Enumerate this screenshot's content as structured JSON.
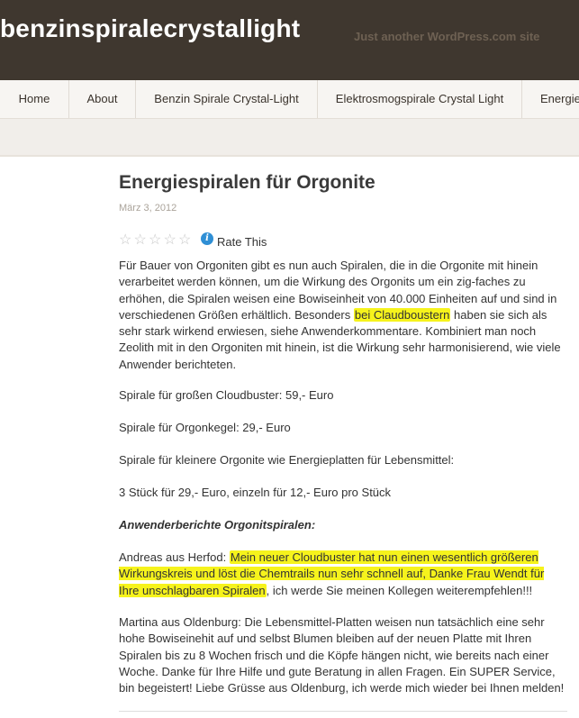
{
  "header": {
    "site_title": "benzinspiralecrystallight",
    "tagline": "Just another WordPress.com site"
  },
  "nav": {
    "items": [
      {
        "label": "Home"
      },
      {
        "label": "About"
      },
      {
        "label": "Benzin Spirale Crystal-Light"
      },
      {
        "label": "Elektrosmogspirale Crystal Light"
      },
      {
        "label": "Energie"
      }
    ]
  },
  "post": {
    "title": "Energiespiralen für Orgonite",
    "date": "März 3, 2012",
    "rating": {
      "stars_filled": 0,
      "stars_total": 5,
      "rate_label": "Rate This",
      "info_icon": "info-icon"
    },
    "p1_a": "Für Bauer von Orgoniten gibt es nun auch Spiralen, die in die Orgonite mit hinein verarbeitet werden können, um die Wirkung des Orgonits um ein zig-faches zu erhöhen, die Spiralen weisen eine Bowiseinheit von 40.000 Einheiten auf und sind in verschiedenen Größen erhältlich. Besonders ",
    "p1_hl": "bei Claudboustern",
    "p1_b": " haben sie sich als sehr stark wirkend erwiesen, siehe Anwenderkommentare. Kombiniert man noch Zeolith mit in den Orgoniten mit hinein, ist die Wirkung sehr harmonisierend, wie viele Anwender berichteten.",
    "price1": "Spirale für großen Cloudbuster: 59,- Euro",
    "price2": "Spirale für Orgonkegel: 29,- Euro",
    "price3": "Spirale für kleinere Orgonite wie Energieplatten für Lebensmittel:",
    "price4": "3 Stück für 29,- Euro, einzeln für 12,- Euro pro Stück",
    "subheading": "Anwenderberichte Orgonitspiralen:",
    "review1_a": "Andreas aus Herfod: ",
    "review1_hl": "Mein neuer Cloudbuster hat nun einen wesentlich größeren Wirkungskreis und löst die Chemtrails nun sehr schnell auf, Danke Frau Wendt für Ihre unschlagbaren Spiralen",
    "review1_b": ", ich werde Sie meinen Kollegen weiterempfehlen!!!",
    "review2": "Martina aus Oldenburg: Die Lebensmittel-Platten weisen nun tatsächlich eine sehr hohe Bowiseinehit auf und selbst Blumen bleiben auf der neuen Platte mit Ihren Spiralen bis zu 8 Wochen frisch und die Köpfe hängen nicht, wie bereits nach einer Woche. Danke für Ihre Hilfe und gute Beratung in allen Fragen. Ein SUPER Service, bin begeistert! Liebe Grüsse aus Oldenburg, ich werde mich wieder bei Ihnen melden!"
  },
  "colors": {
    "header_bg": "#3f372f",
    "highlight": "#f6f31c",
    "info_icon": "#2f8fd5"
  }
}
